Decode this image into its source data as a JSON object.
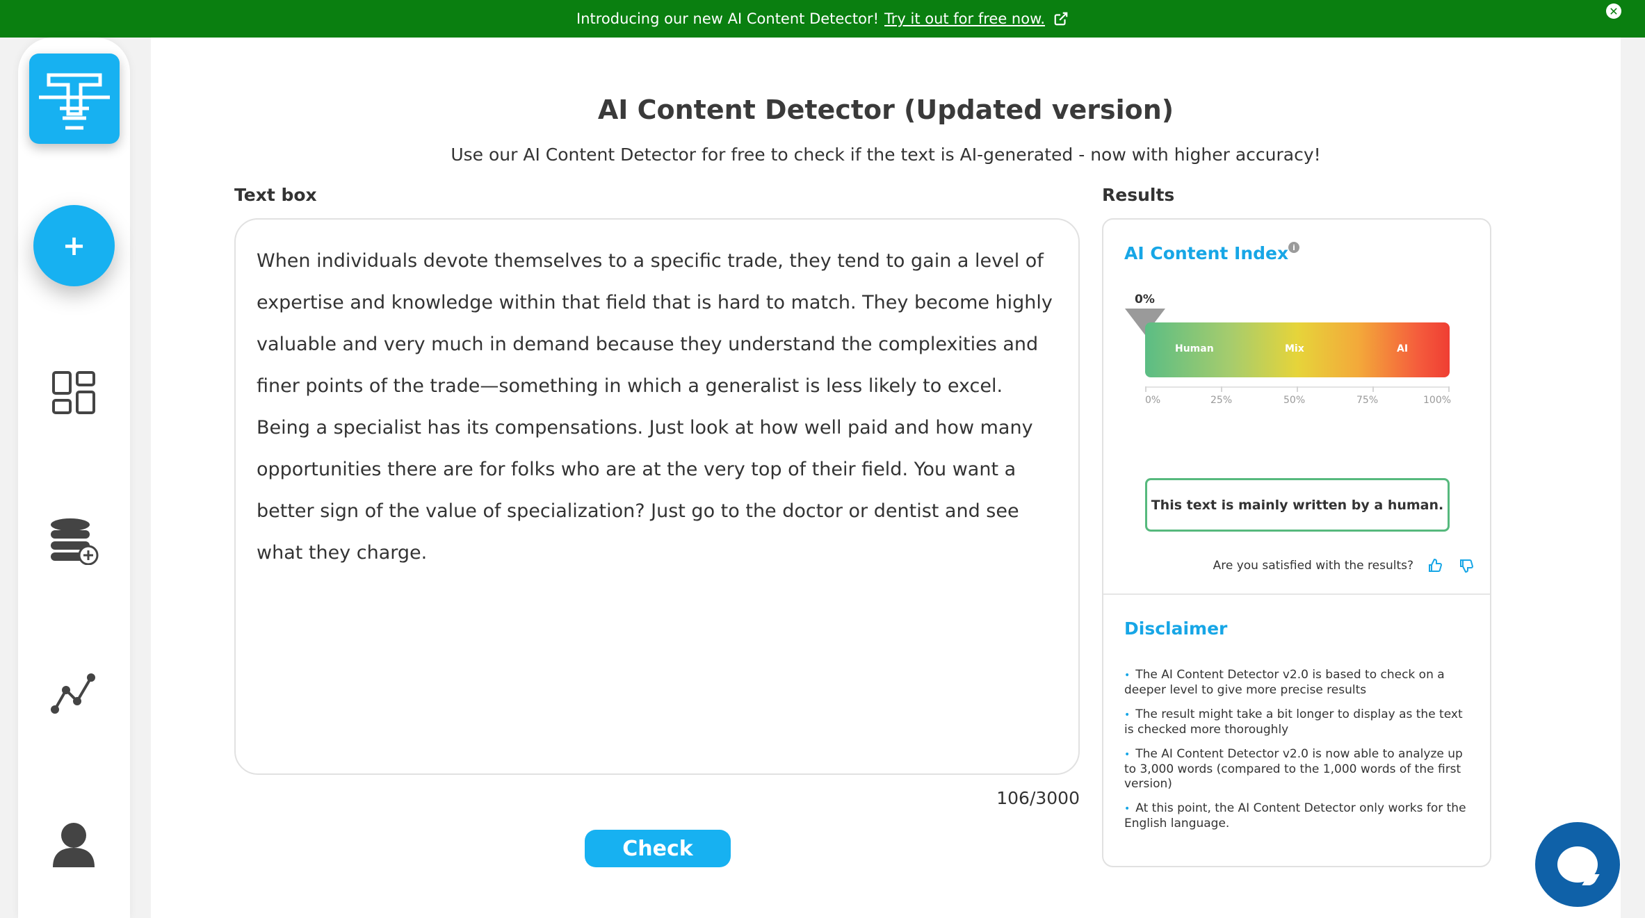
{
  "banner": {
    "text": "Introducing our new AI Content Detector!",
    "link": "Try it out for free now."
  },
  "sidebar": {
    "items": [
      {
        "icon": "logo-icon"
      },
      {
        "icon": "plus-icon"
      },
      {
        "icon": "dashboard-icon"
      },
      {
        "icon": "database-add-icon"
      },
      {
        "icon": "analytics-icon"
      },
      {
        "icon": "user-icon"
      }
    ]
  },
  "main": {
    "title": "AI Content Detector (Updated version)",
    "subtitle": "Use our AI Content Detector for free to check if the text is AI-generated - now with higher accuracy!",
    "textbox_label": "Text box",
    "results_label": "Results",
    "text": "When individuals devote themselves to a specific trade, they tend to gain a level of expertise and knowledge within that field that is hard to match. They become highly valuable and very much in demand because they understand the complexities and finer points of the trade—something in which a generalist is less likely to excel. Being a specialist has its compensations. Just look at how well paid and how many opportunities there are for folks who are at the very top of their field. You want a better sign of the value of specialization? Just go to the doctor or dentist and see what they charge.",
    "counter": "106/3000",
    "check_label": "Check"
  },
  "results": {
    "index_title": "AI Content Index",
    "info_glyph": "i",
    "score": "0%",
    "gauge": {
      "value": 0,
      "zones": [
        "Human",
        "Mix",
        "AI"
      ],
      "ticks": [
        "0%",
        "25%",
        "50%",
        "75%",
        "100%"
      ]
    },
    "verdict": "This text is mainly written by a human.",
    "satisfied": "Are you satisfied with the results?",
    "disclaimer_title": "Disclaimer",
    "disclaimer_items": [
      "The AI Content Detector v2.0 is based to check on a deeper level to give more precise results",
      "The result might take a bit longer to display as the text is checked more thoroughly",
      "The AI Content Detector v2.0 is now able to analyze up to 3,000 words (compared to the 1,000 words of the first version)",
      "At this point, the AI Content Detector only works for the English language."
    ]
  },
  "colors": {
    "banner": "#0a7f10",
    "accent": "#17b1f1",
    "chat": "#0f61a8",
    "verdict_border": "#56b97d"
  }
}
